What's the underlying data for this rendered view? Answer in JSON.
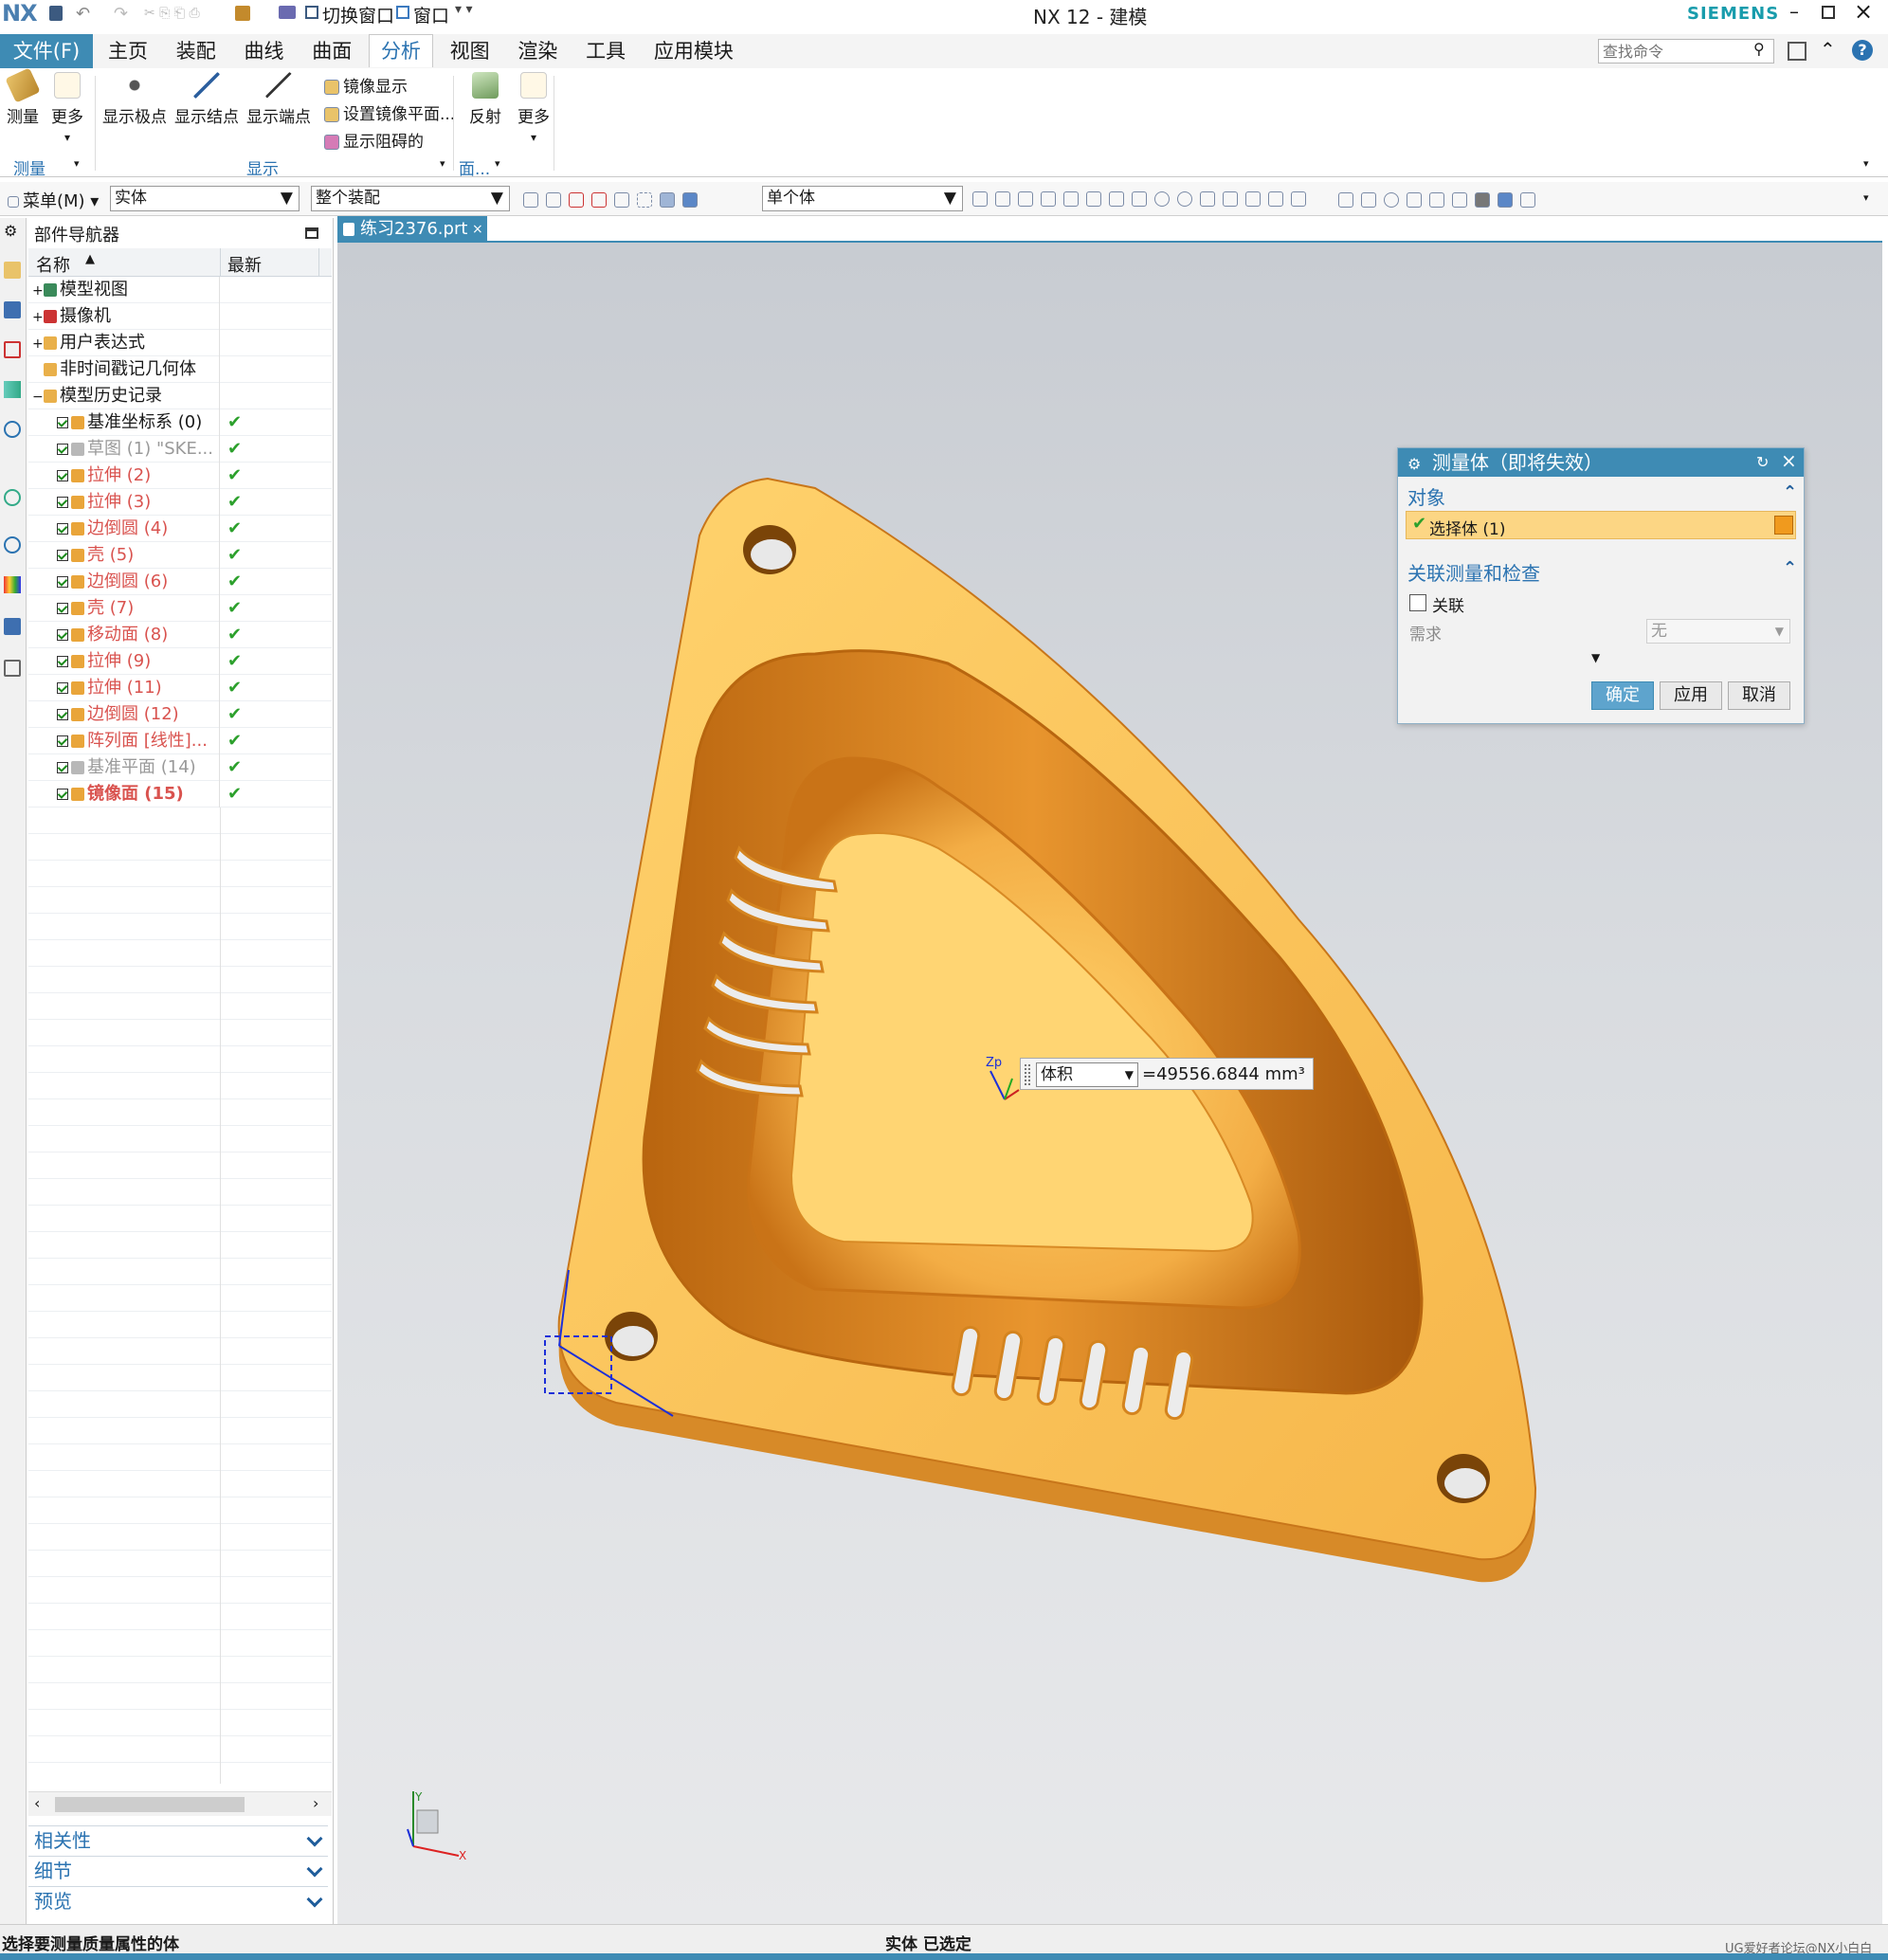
{
  "window": {
    "app_logo": "NX",
    "title": "NX 12 - 建模",
    "brand": "SIEMENS",
    "quick_switch_window": "切换窗口",
    "quick_window": "窗口"
  },
  "menubar": {
    "file": "文件(F)",
    "tabs": [
      "主页",
      "装配",
      "曲线",
      "曲面",
      "分析",
      "视图",
      "渲染",
      "工具",
      "应用模块"
    ],
    "active_tab": "分析",
    "search_placeholder": "查找命令"
  },
  "ribbon": {
    "measure": "测量",
    "more1": "更多",
    "group_measure": "测量",
    "show_poles": "显示极点",
    "show_knots": "显示结点",
    "show_ends": "显示端点",
    "mirror_display": "镜像显示",
    "set_mirror_plane": "设置镜像平面...",
    "show_blocked": "显示阻碍的",
    "group_display": "显示",
    "reflection": "反射",
    "more2": "更多",
    "group_face": "面..."
  },
  "toolbar2": {
    "menu": "菜单(M)",
    "type_filter": "实体",
    "scope_filter": "整个装配",
    "body_mode": "单个体"
  },
  "navigator": {
    "title": "部件导航器",
    "col_name": "名称",
    "col_latest": "最新",
    "items": [
      {
        "label": "模型视图",
        "indent": 0,
        "expander": "+",
        "style": "normal",
        "check": ""
      },
      {
        "label": "摄像机",
        "indent": 0,
        "expander": "+",
        "style": "normal",
        "check": ""
      },
      {
        "label": "用户表达式",
        "indent": 0,
        "expander": "+",
        "style": "normal",
        "check": ""
      },
      {
        "label": "非时间戳记几何体",
        "indent": 0,
        "expander": "",
        "style": "normal",
        "check": ""
      },
      {
        "label": "模型历史记录",
        "indent": 0,
        "expander": "−",
        "style": "normal",
        "check": ""
      },
      {
        "label": "基准坐标系 (0)",
        "indent": 1,
        "expander": "",
        "style": "normal",
        "check": "✔"
      },
      {
        "label": "草图 (1) \"SKE...",
        "indent": 1,
        "expander": "",
        "style": "grey",
        "check": "✔"
      },
      {
        "label": "拉伸 (2)",
        "indent": 1,
        "expander": "",
        "style": "feat",
        "check": "✔"
      },
      {
        "label": "拉伸 (3)",
        "indent": 1,
        "expander": "",
        "style": "feat",
        "check": "✔"
      },
      {
        "label": "边倒圆 (4)",
        "indent": 1,
        "expander": "",
        "style": "feat",
        "check": "✔"
      },
      {
        "label": "壳 (5)",
        "indent": 1,
        "expander": "",
        "style": "feat",
        "check": "✔"
      },
      {
        "label": "边倒圆 (6)",
        "indent": 1,
        "expander": "",
        "style": "feat",
        "check": "✔"
      },
      {
        "label": "壳 (7)",
        "indent": 1,
        "expander": "",
        "style": "feat",
        "check": "✔"
      },
      {
        "label": "移动面 (8)",
        "indent": 1,
        "expander": "",
        "style": "feat",
        "check": "✔"
      },
      {
        "label": "拉伸 (9)",
        "indent": 1,
        "expander": "",
        "style": "feat",
        "check": "✔"
      },
      {
        "label": "拉伸 (11)",
        "indent": 1,
        "expander": "",
        "style": "feat",
        "check": "✔"
      },
      {
        "label": "边倒圆 (12)",
        "indent": 1,
        "expander": "",
        "style": "feat",
        "check": "✔"
      },
      {
        "label": "阵列面 [线性]...",
        "indent": 1,
        "expander": "",
        "style": "feat",
        "check": "✔"
      },
      {
        "label": "基准平面 (14)",
        "indent": 1,
        "expander": "",
        "style": "grey",
        "check": "✔"
      },
      {
        "label": "镜像面 (15)",
        "indent": 1,
        "expander": "",
        "style": "cur",
        "check": "✔"
      }
    ],
    "panels": [
      "相关性",
      "细节",
      "预览"
    ]
  },
  "tab": {
    "label": "练习2376.prt"
  },
  "dialog": {
    "title": "测量体（即将失效）",
    "section_object": "对象",
    "select_body": "选择体 (1)",
    "section_assoc": "关联测量和检查",
    "assoc_label": "关联",
    "requirement_label": "需求",
    "requirement_value": "无",
    "ok": "确定",
    "apply": "应用",
    "cancel": "取消"
  },
  "measure_readout": {
    "dropdown": "体积",
    "value": "=49556.6844 mm³"
  },
  "triad": {
    "z": "Zp",
    "x": "X",
    "y": "Y"
  },
  "status": {
    "prompt": "选择要测量质量属性的体",
    "center": "实体 已选定",
    "watermark": "UG爱好者论坛@NX小白白"
  },
  "colors": {
    "accent": "#3e8bb4",
    "part": "#f7c15c",
    "part_dark": "#e08a1e",
    "feature_red": "#d9534f",
    "check_green": "#2ca02c"
  }
}
